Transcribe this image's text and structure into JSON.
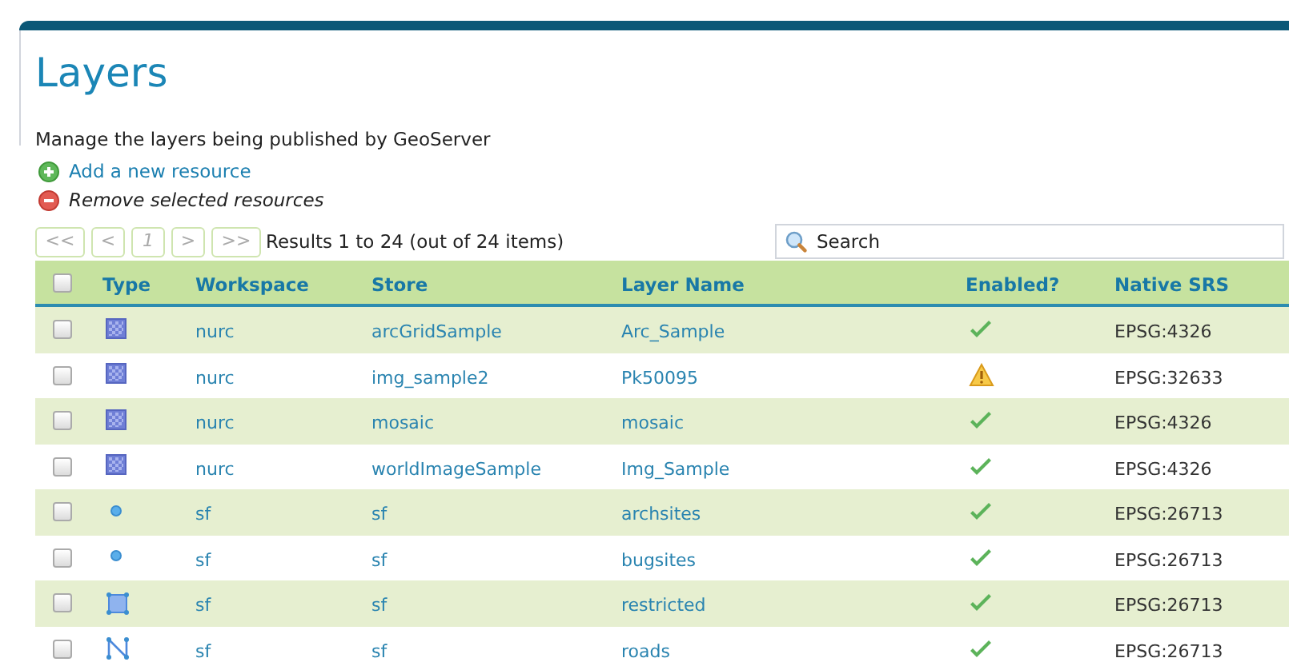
{
  "title": "Layers",
  "description": "Manage the layers being published by GeoServer",
  "actions": [
    {
      "kind": "add",
      "label": "Add a new resource"
    },
    {
      "kind": "remove",
      "label": "Remove selected resources"
    }
  ],
  "pager": {
    "buttons": [
      "<<",
      "<",
      "1",
      ">",
      ">>"
    ],
    "summary": "Results 1 to 24 (out of 24 items)"
  },
  "search": {
    "placeholder": "Search"
  },
  "table": {
    "columns": [
      "Type",
      "Workspace",
      "Store",
      "Layer Name",
      "Enabled?",
      "Native SRS"
    ],
    "header_checked": false,
    "rows": [
      {
        "checked": false,
        "kind": "raster",
        "workspace": "nurc",
        "store": "arcGridSample",
        "layer": "Arc_Sample",
        "enabled": true,
        "srs": "EPSG:4326"
      },
      {
        "checked": false,
        "kind": "raster",
        "workspace": "nurc",
        "store": "img_sample2",
        "layer": "Pk50095",
        "enabled": false,
        "srs": "EPSG:32633"
      },
      {
        "checked": false,
        "kind": "raster",
        "workspace": "nurc",
        "store": "mosaic",
        "layer": "mosaic",
        "enabled": true,
        "srs": "EPSG:4326"
      },
      {
        "checked": false,
        "kind": "raster",
        "workspace": "nurc",
        "store": "worldImageSample",
        "layer": "Img_Sample",
        "enabled": true,
        "srs": "EPSG:4326"
      },
      {
        "checked": false,
        "kind": "point",
        "workspace": "sf",
        "store": "sf",
        "layer": "archsites",
        "enabled": true,
        "srs": "EPSG:26713"
      },
      {
        "checked": false,
        "kind": "point",
        "workspace": "sf",
        "store": "sf",
        "layer": "bugsites",
        "enabled": true,
        "srs": "EPSG:26713"
      },
      {
        "checked": false,
        "kind": "polygon",
        "workspace": "sf",
        "store": "sf",
        "layer": "restricted",
        "enabled": true,
        "srs": "EPSG:26713"
      },
      {
        "checked": false,
        "kind": "line",
        "workspace": "sf",
        "store": "sf",
        "layer": "roads",
        "enabled": true,
        "srs": "EPSG:26713"
      }
    ]
  }
}
